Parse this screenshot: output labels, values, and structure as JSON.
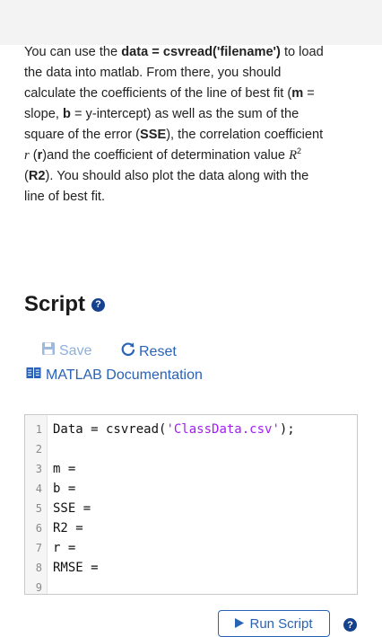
{
  "description": {
    "p1": "You can use the ",
    "b1": "data = csvread('filename')",
    "p2": " to load the data into matlab. From there, you should calculate the coefficients of the line of best fit (",
    "b2": "m",
    "p3": " = slope, ",
    "b3": "b",
    "p4": " = y-intercept) as well as the sum of the square of the error (",
    "b4": "SSE",
    "p5": "), the correlation coefficient ",
    "m1": "r",
    "p6": " (",
    "b5": "r",
    "p7": ")and the coefficient of determination value ",
    "m2": "R",
    "m2sup": "2",
    "p8": " (",
    "b6": "R2",
    "p9": "). You should also plot the data along with the line of best fit."
  },
  "script": {
    "title": "Script",
    "save_label": "Save",
    "reset_label": "Reset",
    "doc_label": "MATLAB Documentation",
    "run_label": "Run Script"
  },
  "code": {
    "lines": [
      {
        "num": "1",
        "pre": "Data = csvread(",
        "str": "'ClassData.csv'",
        "post": ");"
      },
      {
        "num": "2",
        "pre": "",
        "str": "",
        "post": ""
      },
      {
        "num": "3",
        "pre": "m =",
        "str": "",
        "post": ""
      },
      {
        "num": "4",
        "pre": "b =",
        "str": "",
        "post": ""
      },
      {
        "num": "5",
        "pre": "SSE =",
        "str": "",
        "post": ""
      },
      {
        "num": "6",
        "pre": "R2 =",
        "str": "",
        "post": ""
      },
      {
        "num": "7",
        "pre": "r =",
        "str": "",
        "post": ""
      },
      {
        "num": "8",
        "pre": "RMSE =",
        "str": "",
        "post": ""
      },
      {
        "num": "9",
        "pre": "",
        "str": "",
        "post": ""
      }
    ]
  },
  "icons": {
    "help": "question-circle-icon",
    "save": "floppy-disk-icon",
    "reset": "refresh-icon",
    "doc": "book-icon",
    "run": "play-icon"
  },
  "colors": {
    "accent": "#2a62b6",
    "help": "#16418d",
    "string": "#a020f0"
  }
}
